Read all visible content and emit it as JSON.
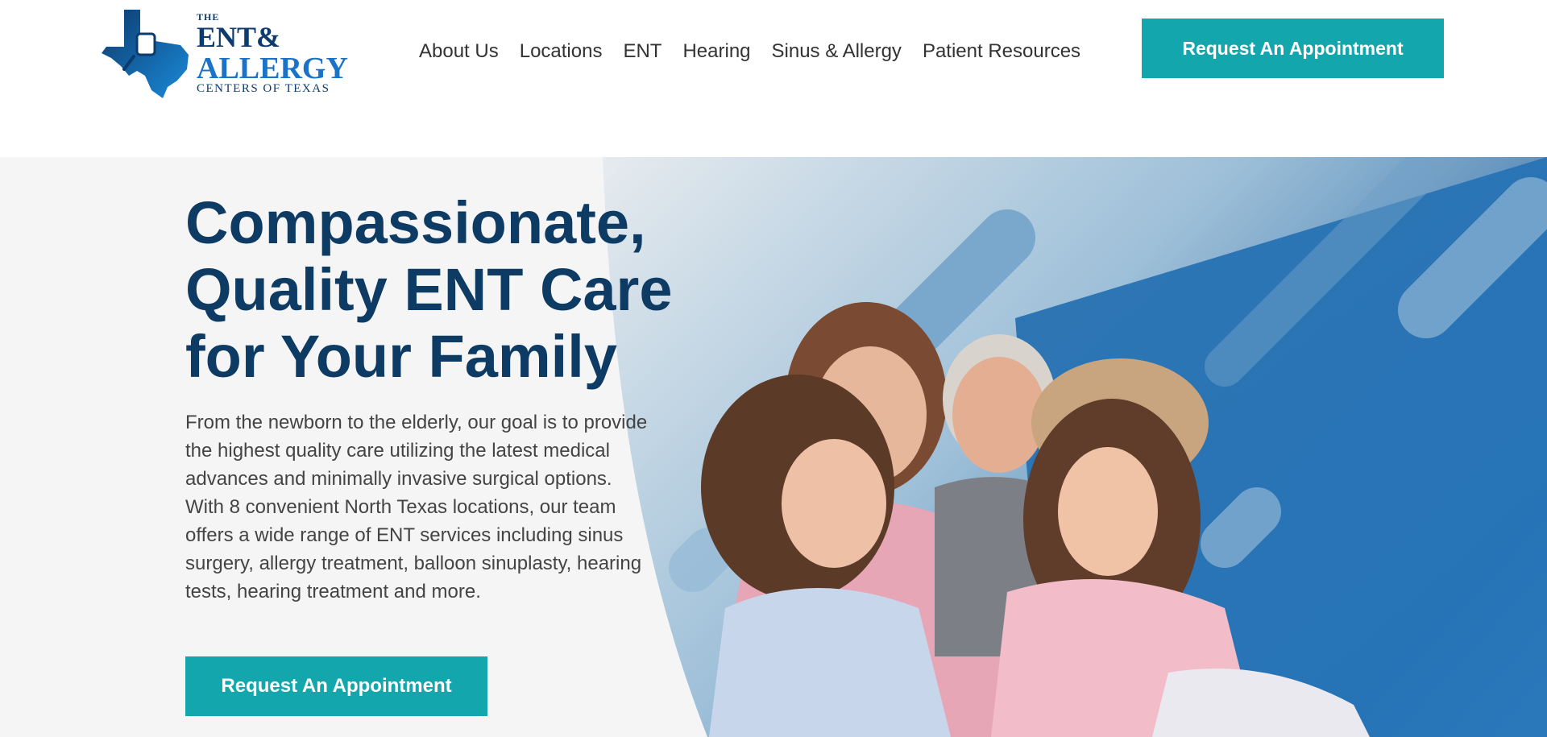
{
  "brand": {
    "logo_line1": "THE",
    "logo_line2": "ENT&",
    "logo_line3": "ALLERGY",
    "logo_line4": "CENTERS OF TEXAS",
    "colors": {
      "primary_navy": "#0d3b64",
      "logo_blue": "#1a73c8",
      "accent_teal": "#14a6ad"
    }
  },
  "nav": {
    "items": [
      {
        "label": "About Us"
      },
      {
        "label": "Locations"
      },
      {
        "label": "ENT"
      },
      {
        "label": "Hearing"
      },
      {
        "label": "Sinus & Allergy"
      },
      {
        "label": "Patient Resources"
      }
    ],
    "cta_label": "Request An Appointment"
  },
  "hero": {
    "headline_lines": [
      "Compassionate,",
      "Quality ENT Care",
      "for Your Family"
    ],
    "body": "From the newborn to the elderly, our goal is to provide the highest quality care utilizing the latest medical advances and minimally invasive surgical options. With 8 convenient North Texas locations, our team offers a wide range of ENT services including sinus surgery, allergy treatment, balloon sinuplasty, hearing tests, hearing treatment and more.",
    "cta_label": "Request An Appointment",
    "image_icon": "family-photo"
  }
}
